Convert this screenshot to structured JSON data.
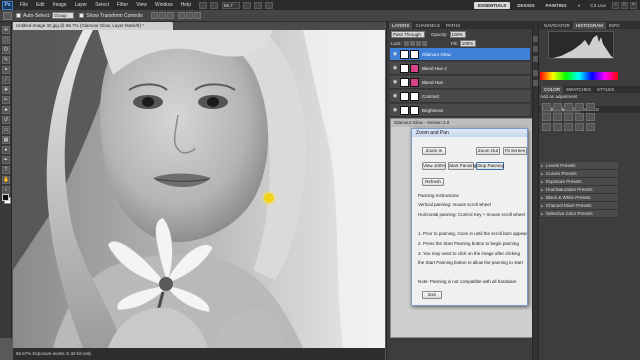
{
  "app": {
    "logo_text": "Ps"
  },
  "menu": [
    "File",
    "Edit",
    "Image",
    "Layer",
    "Select",
    "Filter",
    "View",
    "Window",
    "Help"
  ],
  "menubar": {
    "zoom": "66.7",
    "workspaces": [
      "ESSENTIALS",
      "DESIGN",
      "PAINTING"
    ],
    "more": "»",
    "cs_live": "CS Live",
    "window_controls": [
      "–",
      "□",
      "×"
    ]
  },
  "options": {
    "auto_select_label": "Auto-Select:",
    "auto_select_value": "Group",
    "transform_label": "Show Transform Controls"
  },
  "document": {
    "tab_title": "Untitled-Image 32.jpg @ 66.7% (Glamour Glow, Layer Mask/8) *",
    "status": "66.67%    Exposure works in 32-bit only"
  },
  "layers_panel": {
    "tabs": [
      "LAYERS",
      "CHANNELS",
      "PATHS"
    ],
    "blend_mode": "Pass Through",
    "opacity_label": "Opacity:",
    "opacity_value": "100%",
    "lock_label": "Lock:",
    "fill_label": "Fill:",
    "fill_value": "100%",
    "layers": [
      {
        "name": "Glamour Glow",
        "selected": true,
        "mask": "#ffffff"
      },
      {
        "name": "Blend Hue 2",
        "selected": false,
        "mask": "#d8428a"
      },
      {
        "name": "Blend Hue",
        "selected": false,
        "mask": "#d8428a"
      },
      {
        "name": "Contrast",
        "selected": false,
        "mask": "#ffffff"
      },
      {
        "name": "Brightness",
        "selected": false,
        "mask": "#ffffff"
      }
    ]
  },
  "glamour_panel": {
    "title": "Glamour Glow - Version 2.0"
  },
  "zoom_dialog": {
    "title": "Zoom and Pan",
    "buttons": {
      "zoom_in": "Zoom In",
      "zoom_out": "Zoom Out",
      "fit_screen": "Fit Screen",
      "view_100": "View 100%",
      "start_panning": "Start Panning",
      "stop_panning": "Stop Panning",
      "refresh": "Refresh",
      "exit": "Exit"
    },
    "instructions": {
      "heading": "Panning Instructions",
      "vertical": "Vertical panning: mouse scroll wheel",
      "horizontal": "Horizontal panning: Control Key + mouse scroll wheel",
      "step1": "1. Prior to panning, zoom in until the scroll bars appear",
      "step2": "2. Press the Start Panning button to begin panning",
      "step3a": "3. You may need to click on the image after clicking",
      "step3b": "the Start Panning button to allow the panning to start",
      "note": "Note: Panning is not compatible with all hardware"
    }
  },
  "right_dock": {
    "tabs_top": [
      "NAVIGATOR",
      "HISTOGRAM",
      "INFO"
    ],
    "tabs_mid": [
      "COLOR",
      "SWATCHES",
      "STYLES"
    ],
    "tabs_adj": [
      "ADJUSTMENTS",
      "MASKS"
    ],
    "adj_label": "Add an adjustment",
    "presets": [
      "Levels Presets",
      "Curves Presets",
      "Exposure Presets",
      "Hue/Saturation Presets",
      "Black & White Presets",
      "Channel Mixer Presets",
      "Selective Color Presets"
    ]
  }
}
